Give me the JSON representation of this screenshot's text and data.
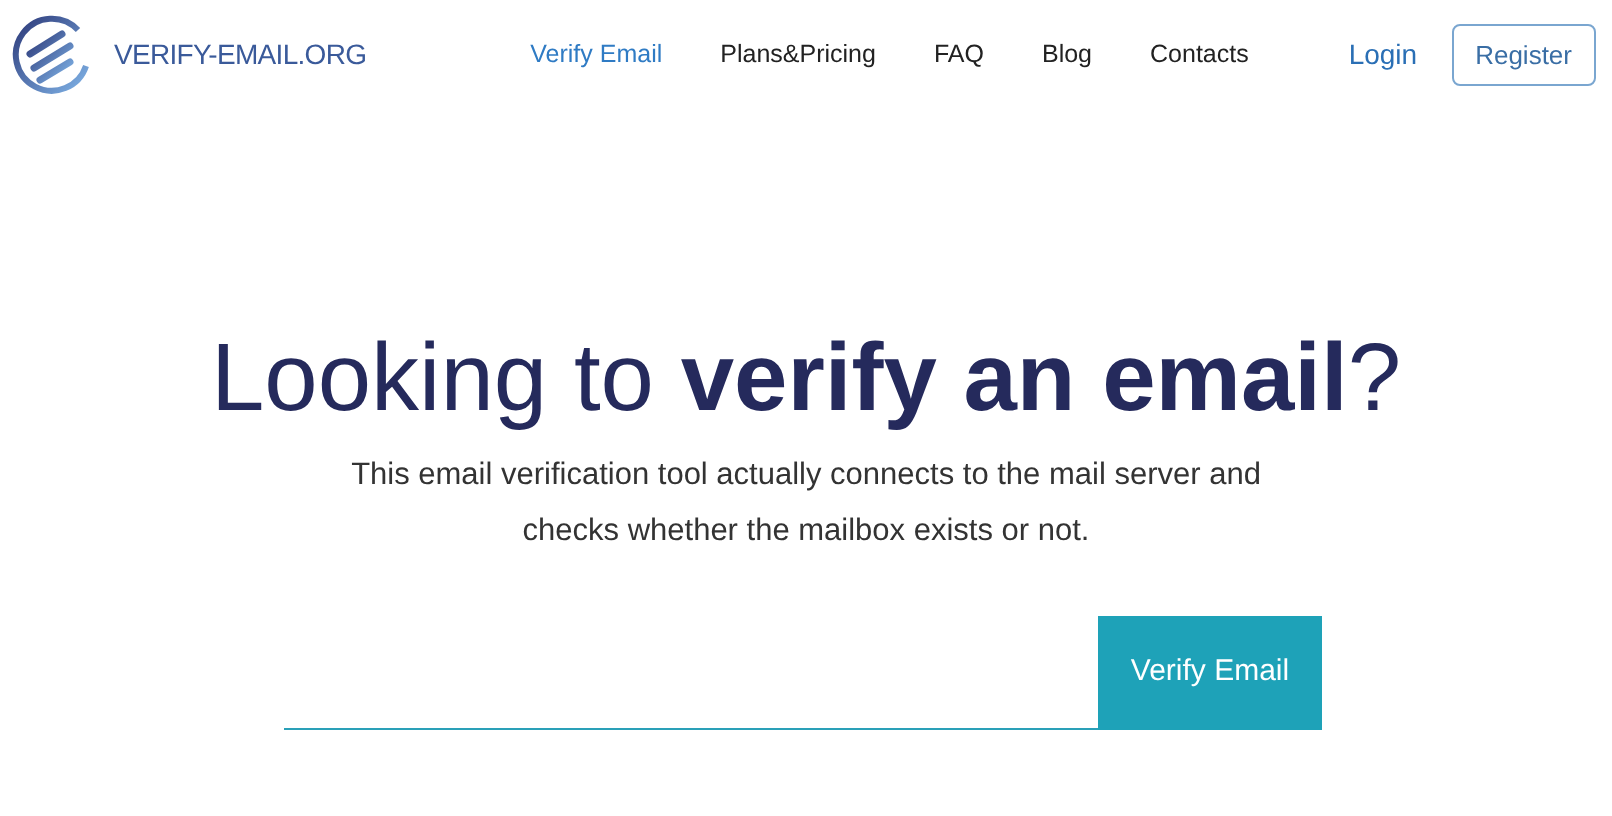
{
  "logo": {
    "text": "VERIFY-EMAIL.ORG"
  },
  "nav": [
    {
      "label": "Verify Email",
      "selected": true
    },
    {
      "label": "Plans&Pricing",
      "selected": false
    },
    {
      "label": "FAQ",
      "selected": false
    },
    {
      "label": "Blog",
      "selected": false
    },
    {
      "label": "Contacts",
      "selected": false
    }
  ],
  "login": "Login",
  "register": "Register",
  "headline": "Looking to **verify an email**?",
  "subtitle": "This email verification tool actually connects to the mail server and checks whether the mailbox exists or not.",
  "form": {
    "button": "Verify Email"
  }
}
